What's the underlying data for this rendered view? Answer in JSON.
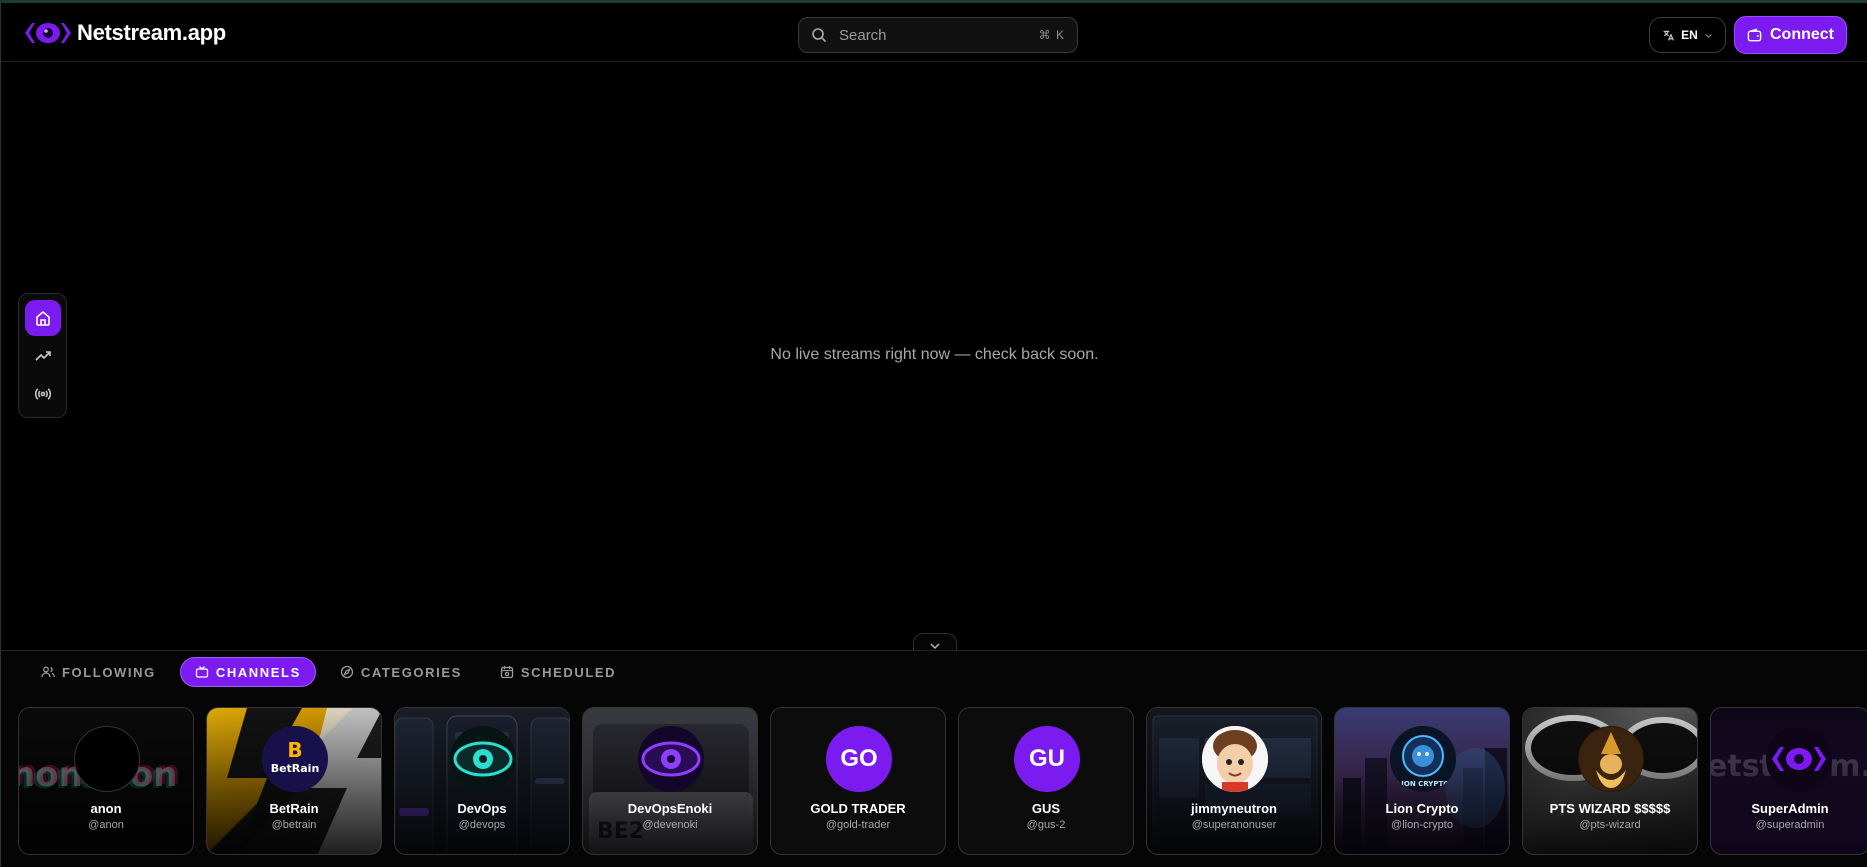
{
  "header": {
    "app_name": "Netstream.app",
    "search_placeholder": "Search",
    "search_shortcut": "⌘ K",
    "language": "EN",
    "connect_label": "Connect"
  },
  "rail": {
    "items": [
      {
        "icon": "home-icon",
        "active": true
      },
      {
        "icon": "trending-icon",
        "active": false
      },
      {
        "icon": "broadcast-icon",
        "active": false
      }
    ]
  },
  "main": {
    "empty_message": "No live streams right now — check back soon."
  },
  "dock": {
    "tabs": [
      {
        "label": "FOLLOWING",
        "icon": "users-icon",
        "active": false
      },
      {
        "label": "CHANNELS",
        "icon": "tv-icon",
        "active": true
      },
      {
        "label": "CATEGORIES",
        "icon": "compass-icon",
        "active": false
      },
      {
        "label": "SCHEDULED",
        "icon": "calendar-icon",
        "active": false
      }
    ],
    "channels": [
      {
        "name": "anon",
        "handle": "@anon",
        "initials": ""
      },
      {
        "name": "BetRain",
        "handle": "@betrain",
        "initials": ""
      },
      {
        "name": "DevOps",
        "handle": "@devops",
        "initials": ""
      },
      {
        "name": "DevOpsEnoki",
        "handle": "@devenoki",
        "initials": ""
      },
      {
        "name": "GOLD TRADER",
        "handle": "@gold-trader",
        "initials": "GO"
      },
      {
        "name": "GUS",
        "handle": "@gus-2",
        "initials": "GU"
      },
      {
        "name": "jimmyneutron",
        "handle": "@superanonuser",
        "initials": ""
      },
      {
        "name": "Lion Crypto",
        "handle": "@lion-crypto",
        "initials": ""
      },
      {
        "name": "PTS WIZARD $$$$$",
        "handle": "@pts-wizard",
        "initials": ""
      },
      {
        "name": "SuperAdmin",
        "handle": "@superadmin",
        "initials": ""
      }
    ]
  },
  "colors": {
    "accent": "#7c1bf0",
    "background": "#000000",
    "muted_text": "#a8a8a8"
  }
}
